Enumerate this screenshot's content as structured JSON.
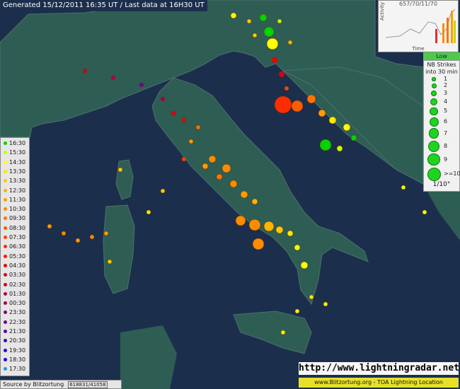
{
  "header": {
    "text": "Generated 15/12/2011 16:35 UT / Last data at 16H30 UT"
  },
  "activity": {
    "title": "657/70/11/70",
    "ylabel": "Activity",
    "xlabel": "Time"
  },
  "low_label": "Low",
  "strikes_legend": {
    "title_line1": "NB Strikes",
    "title_line2": "into 30 min",
    "items": [
      {
        "label": "1",
        "size": 1
      },
      {
        "label": "2",
        "size": 2
      },
      {
        "label": "3",
        "size": 3
      },
      {
        "label": "4",
        "size": 4
      },
      {
        "label": "5",
        "size": 5
      },
      {
        "label": "6",
        "size": 6
      },
      {
        "label": "7",
        "size": 7
      },
      {
        "label": "8",
        "size": 8
      },
      {
        "label": "9",
        "size": 9
      },
      {
        "label": ">=10",
        "size": 10
      }
    ]
  },
  "scale_label": "1/10°",
  "time_legend": [
    {
      "label": "16:30",
      "color": "#00d400"
    },
    {
      "label": "15:30",
      "color": "#c8ff00"
    },
    {
      "label": "14:30",
      "color": "#ffff00"
    },
    {
      "label": "13:30",
      "color": "#ffe800"
    },
    {
      "label": "13:30",
      "color": "#ffcc00"
    },
    {
      "label": "12:30",
      "color": "#ffb400"
    },
    {
      "label": "11:30",
      "color": "#ff9c00"
    },
    {
      "label": "10:30",
      "color": "#ff8c00"
    },
    {
      "label": "09:30",
      "color": "#ff7400"
    },
    {
      "label": "08:30",
      "color": "#ff5c00"
    },
    {
      "label": "07:30",
      "color": "#ff4400"
    },
    {
      "label": "06:30",
      "color": "#ff2c00"
    },
    {
      "label": "05:30",
      "color": "#ff1400"
    },
    {
      "label": "04:30",
      "color": "#f00000"
    },
    {
      "label": "03:30",
      "color": "#dc0014"
    },
    {
      "label": "02:30",
      "color": "#c8002c"
    },
    {
      "label": "01:30",
      "color": "#b00044"
    },
    {
      "label": "00:30",
      "color": "#9c005c"
    },
    {
      "label": "23:30",
      "color": "#840074"
    },
    {
      "label": "22:30",
      "color": "#70008c"
    },
    {
      "label": "21:30",
      "color": "#5a00a4"
    },
    {
      "label": "20:30",
      "color": "#4400bc"
    },
    {
      "label": "19:30",
      "color": "#3000d4"
    },
    {
      "label": "18:30",
      "color": "#1800e8"
    },
    {
      "label": "17:30",
      "color": "#1e9be0"
    }
  ],
  "source_label": "Source by Blitzortung",
  "source_id": "618831/41058",
  "url_label": "http://www.lightningradar.net",
  "footer_label": "www.Blitzortung.org - TOA Lightning Location",
  "map": {
    "sea_color": "#1b2f4d",
    "land_color": "#2e5d54",
    "border_color": "#4f6f6b"
  }
}
